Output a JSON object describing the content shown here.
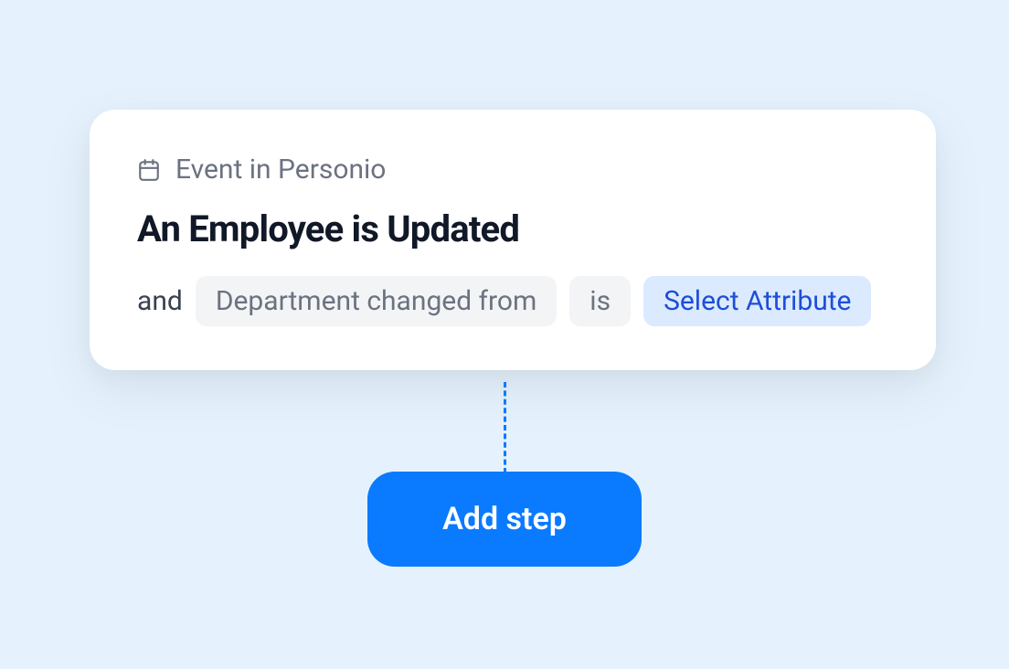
{
  "card": {
    "header_label": "Event in Personio",
    "title": "An Employee is Updated",
    "condition": {
      "prefix": "and",
      "attribute_pill": "Department changed from",
      "operator_pill": "is",
      "value_pill": "Select Attribute"
    }
  },
  "add_step_button": "Add step"
}
